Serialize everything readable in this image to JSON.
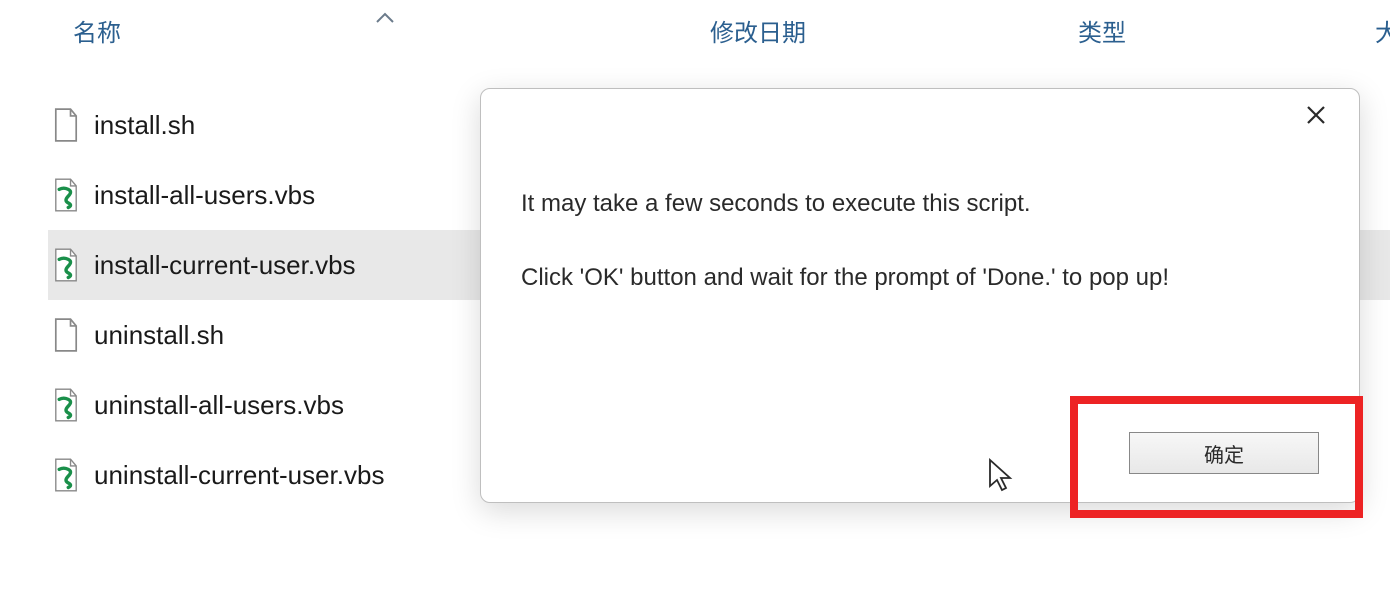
{
  "columns": {
    "name": "名称",
    "modified": "修改日期",
    "type": "类型",
    "size": "大"
  },
  "files": [
    {
      "name": "install.sh",
      "icon": "file",
      "selected": false
    },
    {
      "name": "install-all-users.vbs",
      "icon": "vbs",
      "selected": false
    },
    {
      "name": "install-current-user.vbs",
      "icon": "vbs",
      "selected": true
    },
    {
      "name": "uninstall.sh",
      "icon": "file",
      "selected": false
    },
    {
      "name": "uninstall-all-users.vbs",
      "icon": "vbs",
      "selected": false
    },
    {
      "name": "uninstall-current-user.vbs",
      "icon": "vbs",
      "selected": false
    }
  ],
  "dialog": {
    "line1": "It may take a few seconds to execute this script.",
    "line2": "Click 'OK' button and wait for the prompt of 'Done.' to pop up!",
    "ok_label": "确定"
  }
}
